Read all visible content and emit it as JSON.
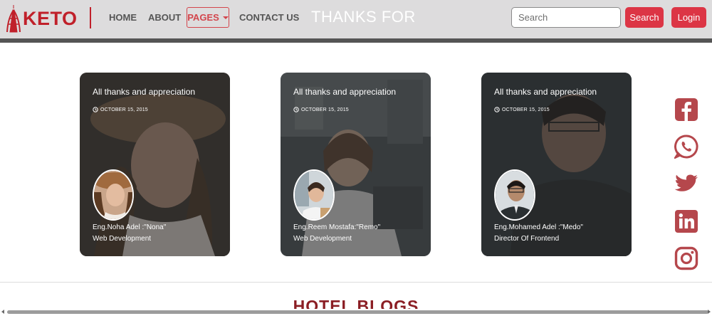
{
  "brand": {
    "name": "KETO",
    "color": "#c0202a"
  },
  "nav": {
    "home": "HOME",
    "about": "ABOUT",
    "pages": "PAGES",
    "contact": "CONTACT US"
  },
  "hero_title": "THANKS FOR",
  "search": {
    "placeholder": "Search",
    "button": "Search"
  },
  "login_label": "Login",
  "cards": [
    {
      "title": "All thanks and appreciation",
      "date": "OCTOBER 15, 2015",
      "name": "Eng.Noha Adel :\"Nona\"",
      "role": "Web Development"
    },
    {
      "title": "All thanks and appreciation",
      "date": "OCTOBER 15, 2015",
      "name": "Eng.Reem Mostafa:\"Remo\"",
      "role": "Web Development"
    },
    {
      "title": "All thanks and appreciation",
      "date": "OCTOBER 15, 2015",
      "name": "Eng.Mohamed Adel :\"Medo\"",
      "role": "Director Of Frontend"
    }
  ],
  "social_icons": [
    "facebook-icon",
    "whatsapp-icon",
    "twitter-icon",
    "linkedin-icon",
    "instagram-icon"
  ],
  "blogs_heading": "HOTEL BLOGS",
  "colors": {
    "accent": "#dc3545",
    "social": "#b5474c",
    "nav_bar": "#dddcdd"
  }
}
